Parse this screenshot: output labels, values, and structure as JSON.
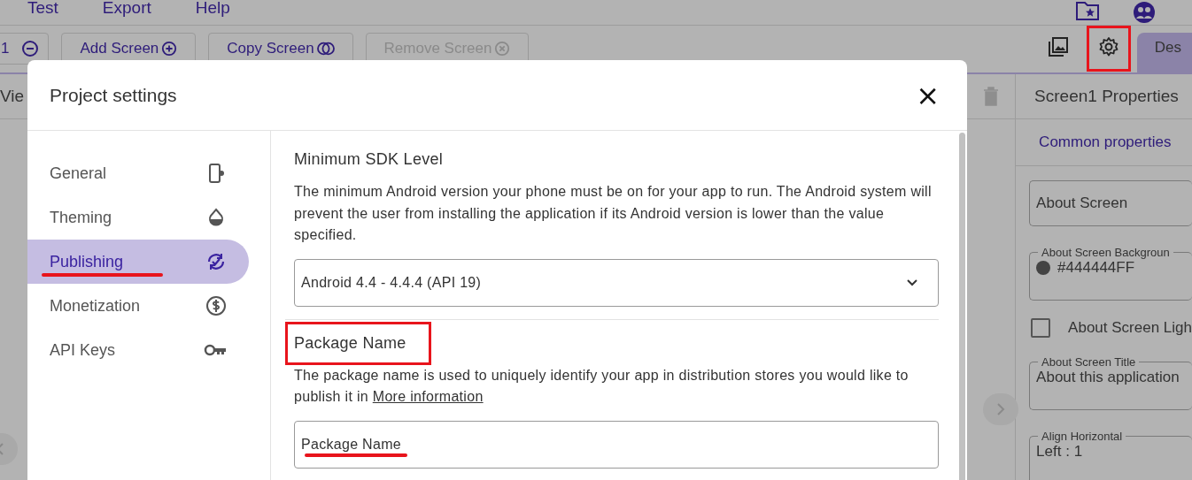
{
  "menu_bar": {
    "items": [
      "Test",
      "Export",
      "Help"
    ]
  },
  "toolbar": {
    "screen_number": "1",
    "buttons": [
      {
        "label": "Add Screen",
        "kind": "add",
        "disabled": false
      },
      {
        "label": "Copy Screen",
        "kind": "copy",
        "disabled": false
      },
      {
        "label": "Remove Screen",
        "kind": "remove",
        "disabled": true
      }
    ]
  },
  "tabs": [
    {
      "label": "Des",
      "selected": true
    }
  ],
  "viewer": {
    "title": "Vie"
  },
  "properties_panel": {
    "title": "Screen1 Properties",
    "tab": "Common properties",
    "fields": [
      {
        "kind": "text",
        "value": "About Screen"
      },
      {
        "kind": "color",
        "label": "About Screen Backgroun",
        "value": "#444444FF",
        "color": "#444444"
      },
      {
        "kind": "checkbox",
        "label": "About Screen Ligh",
        "checked": false
      },
      {
        "kind": "text",
        "label": "About Screen Title",
        "value": "About this application"
      },
      {
        "kind": "text",
        "label": "Align Horizontal",
        "value": "Left : 1"
      }
    ]
  },
  "dialog": {
    "title": "Project settings",
    "close": "×",
    "nav": [
      {
        "label": "General",
        "selected": false
      },
      {
        "label": "Theming",
        "selected": false
      },
      {
        "label": "Publishing",
        "selected": true
      },
      {
        "label": "Monetization",
        "selected": false
      },
      {
        "label": "API Keys",
        "selected": false
      }
    ],
    "sections": [
      {
        "kind": "select",
        "heading": "Minimum SDK Level",
        "description": "The minimum Android version your phone must be on for your app to run. The Android system will prevent the user from installing the application if its Android version is lower than the value specified.",
        "value": "Android 4.4 - 4.4.4 (API 19)"
      },
      {
        "kind": "input",
        "heading": "Package Name",
        "description": "The package name is used to uniquely identify your app in distribution stores you would like to publish it in",
        "link": "More information",
        "value": "Package Name"
      }
    ]
  }
}
